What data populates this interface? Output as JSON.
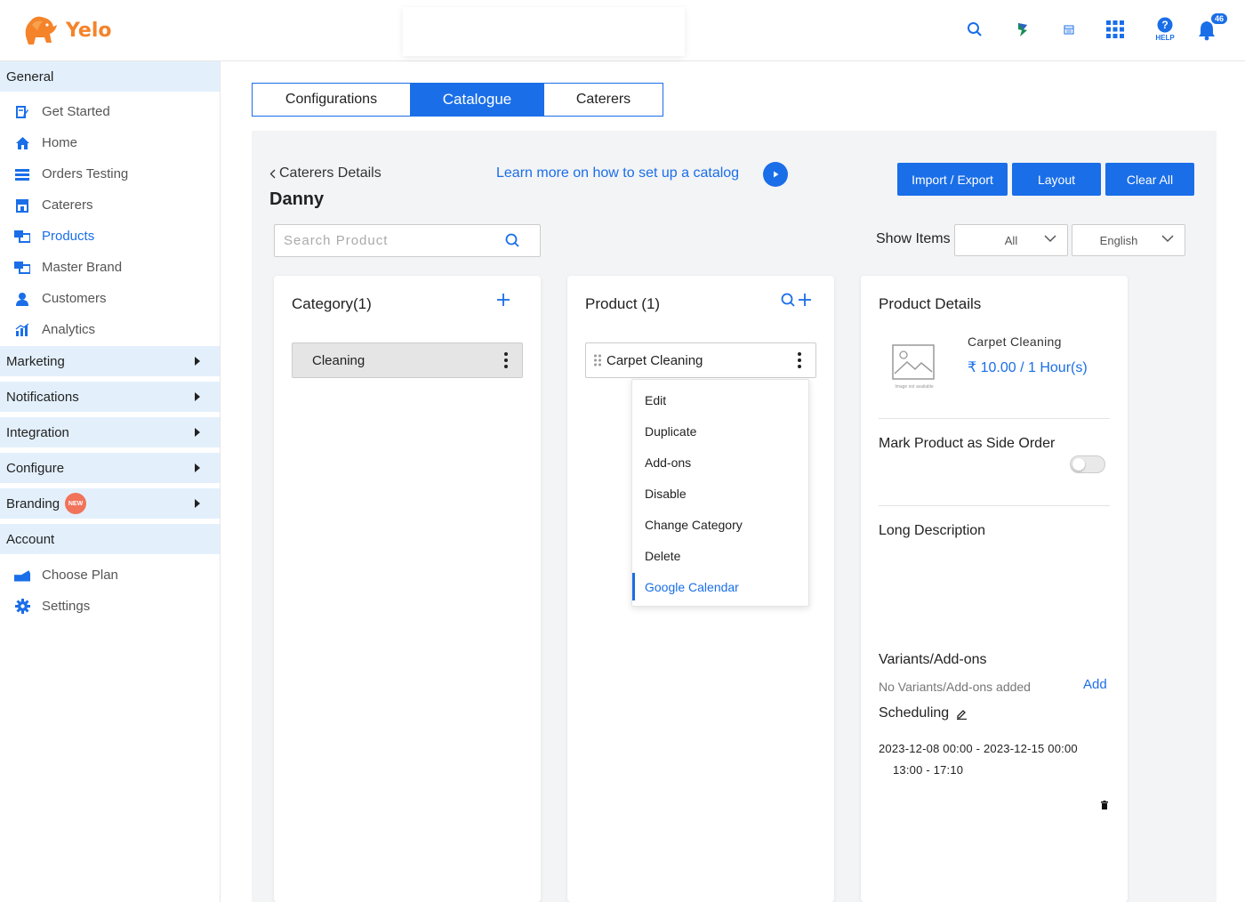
{
  "app": {
    "name": "Yelo",
    "brand_color": "#f5832a",
    "accent": "#1a6ee8"
  },
  "header": {
    "notification_count": "46",
    "help_label": "HELP"
  },
  "sidebar": {
    "general": "General",
    "items": [
      {
        "label": "Get Started",
        "icon": "edit-icon"
      },
      {
        "label": "Home",
        "icon": "home-icon"
      },
      {
        "label": "Orders Testing",
        "icon": "orders-icon"
      },
      {
        "label": "Caterers",
        "icon": "store-icon"
      },
      {
        "label": "Products",
        "icon": "products-icon"
      },
      {
        "label": "Master Brand",
        "icon": "brand-icon"
      },
      {
        "label": "Customers",
        "icon": "user-icon"
      },
      {
        "label": "Analytics",
        "icon": "chart-icon"
      }
    ],
    "sections": [
      "Marketing",
      "Notifications",
      "Integration",
      "Configure",
      "Branding"
    ],
    "new_badge": "NEW",
    "account": "Account",
    "account_items": [
      {
        "label": "Choose Plan",
        "icon": "plan-icon"
      },
      {
        "label": "Settings",
        "icon": "gear-icon"
      }
    ]
  },
  "tabs": [
    "Configurations",
    "Catalogue",
    "Caterers"
  ],
  "catalogue": {
    "back_label": "Caterers Details",
    "title": "Danny",
    "learn_more": "Learn more on how to set up a catalog",
    "buttons": {
      "import_export": "Import / Export",
      "layout": "Layout",
      "clear_all": "Clear All"
    },
    "search_placeholder": "Search Product",
    "show_items_label": "Show Items",
    "show_items_value": "All",
    "language_value": "English"
  },
  "category": {
    "title": "Category(1)",
    "items": [
      "Cleaning"
    ]
  },
  "product": {
    "title": "Product (1)",
    "items": [
      "Carpet Cleaning"
    ],
    "menu": [
      "Edit",
      "Duplicate",
      "Add-ons",
      "Disable",
      "Change Category",
      "Delete",
      "Google Calendar"
    ]
  },
  "details": {
    "title": "Product Details",
    "name": "Carpet Cleaning",
    "price": "₹ 10.00 / 1 Hour(s)",
    "image_placeholder": "Image not available",
    "side_order_label": "Mark Product as Side Order",
    "side_order_enabled": false,
    "long_desc_label": "Long Description",
    "variants_label": "Variants/Add-ons",
    "no_variants": "No Variants/Add-ons added",
    "add_label": "Add",
    "scheduling_label": "Scheduling",
    "schedule_range": "2023-12-08 00:00 - 2023-12-15 00:00",
    "schedule_time": "13:00 - 17:10"
  }
}
